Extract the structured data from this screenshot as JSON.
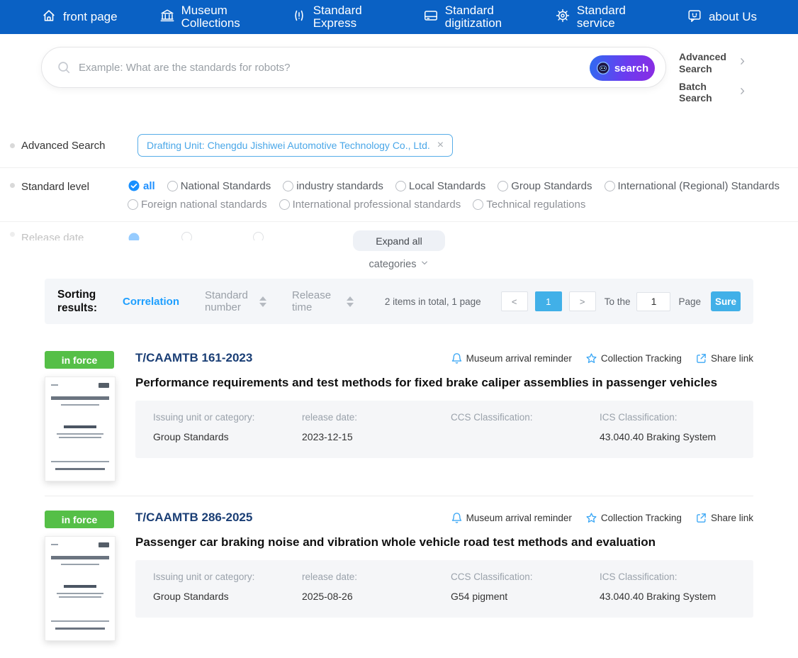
{
  "nav": {
    "items": [
      {
        "label": "front page"
      },
      {
        "label": "Museum Collections"
      },
      {
        "label": "Standard Express"
      },
      {
        "label": "Standard digitization"
      },
      {
        "label": "Standard service"
      },
      {
        "label": "about Us"
      }
    ]
  },
  "search": {
    "placeholder": "Example: What are the standards for robots?",
    "button_label": "search",
    "advanced_link": "Advanced Search",
    "batch_link": "Batch Search"
  },
  "advanced_filter": {
    "label": "Advanced Search",
    "tag": "Drafting Unit: Chengdu Jishiwei Automotive Technology Co., Ltd.",
    "close": "×"
  },
  "standard_level": {
    "label": "Standard level",
    "selected": "all",
    "options_row1": [
      {
        "label": "all"
      },
      {
        "label": "National Standards"
      },
      {
        "label": "industry standards"
      },
      {
        "label": "Local Standards"
      },
      {
        "label": "Group Standards"
      },
      {
        "label": "International (Regional) Standards"
      }
    ],
    "options_row2": [
      {
        "label": "Foreign national standards"
      },
      {
        "label": "International professional standards"
      },
      {
        "label": "Technical regulations"
      }
    ]
  },
  "collapsed": {
    "hidden_row_label": "Release date",
    "expand_button": "Expand all",
    "categories": "categories"
  },
  "sorting": {
    "title": "Sorting results:",
    "correlation": "Correlation",
    "standard_number": "Standard number",
    "release_time": "Release time",
    "total": "2 items in total, 1 page",
    "prev": "<",
    "page": "1",
    "next": ">",
    "to_the": "To the",
    "page_input": "1",
    "page_label": "Page",
    "sure": "Sure"
  },
  "results": {
    "actions": {
      "reminder": "Museum arrival reminder",
      "tracking": "Collection Tracking",
      "share": "Share link"
    },
    "detail_labels": {
      "issuing": "Issuing unit or category:",
      "release": "release date:",
      "ccs": "CCS Classification:",
      "ics": "ICS Classification:"
    },
    "items": [
      {
        "status": "in force",
        "code": "T/CAAMTB 161-2023",
        "title": "Performance requirements and test methods for fixed brake caliper assemblies in passenger vehicles",
        "issuing": "Group Standards",
        "release": "2023-12-15",
        "ccs": "",
        "ics": "43.040.40 Braking System"
      },
      {
        "status": "in force",
        "code": "T/CAAMTB 286-2025",
        "title": "Passenger car braking noise and vibration whole vehicle road test methods and evaluation",
        "issuing": "Group Standards",
        "release": "2025-08-26",
        "ccs": "G54 pigment",
        "ics": "43.040.40 Braking System"
      }
    ]
  },
  "colors": {
    "nav_blue": "#0a61c4",
    "accent_blue": "#1e9fff",
    "pager_blue": "#41b0e8",
    "badge_green": "#55bf47",
    "tag_blue": "#4aa7e8",
    "icon_blue": "#3da8f5",
    "search_gradient_start": "#2e6cf0",
    "search_gradient_end": "#8b2be2"
  }
}
